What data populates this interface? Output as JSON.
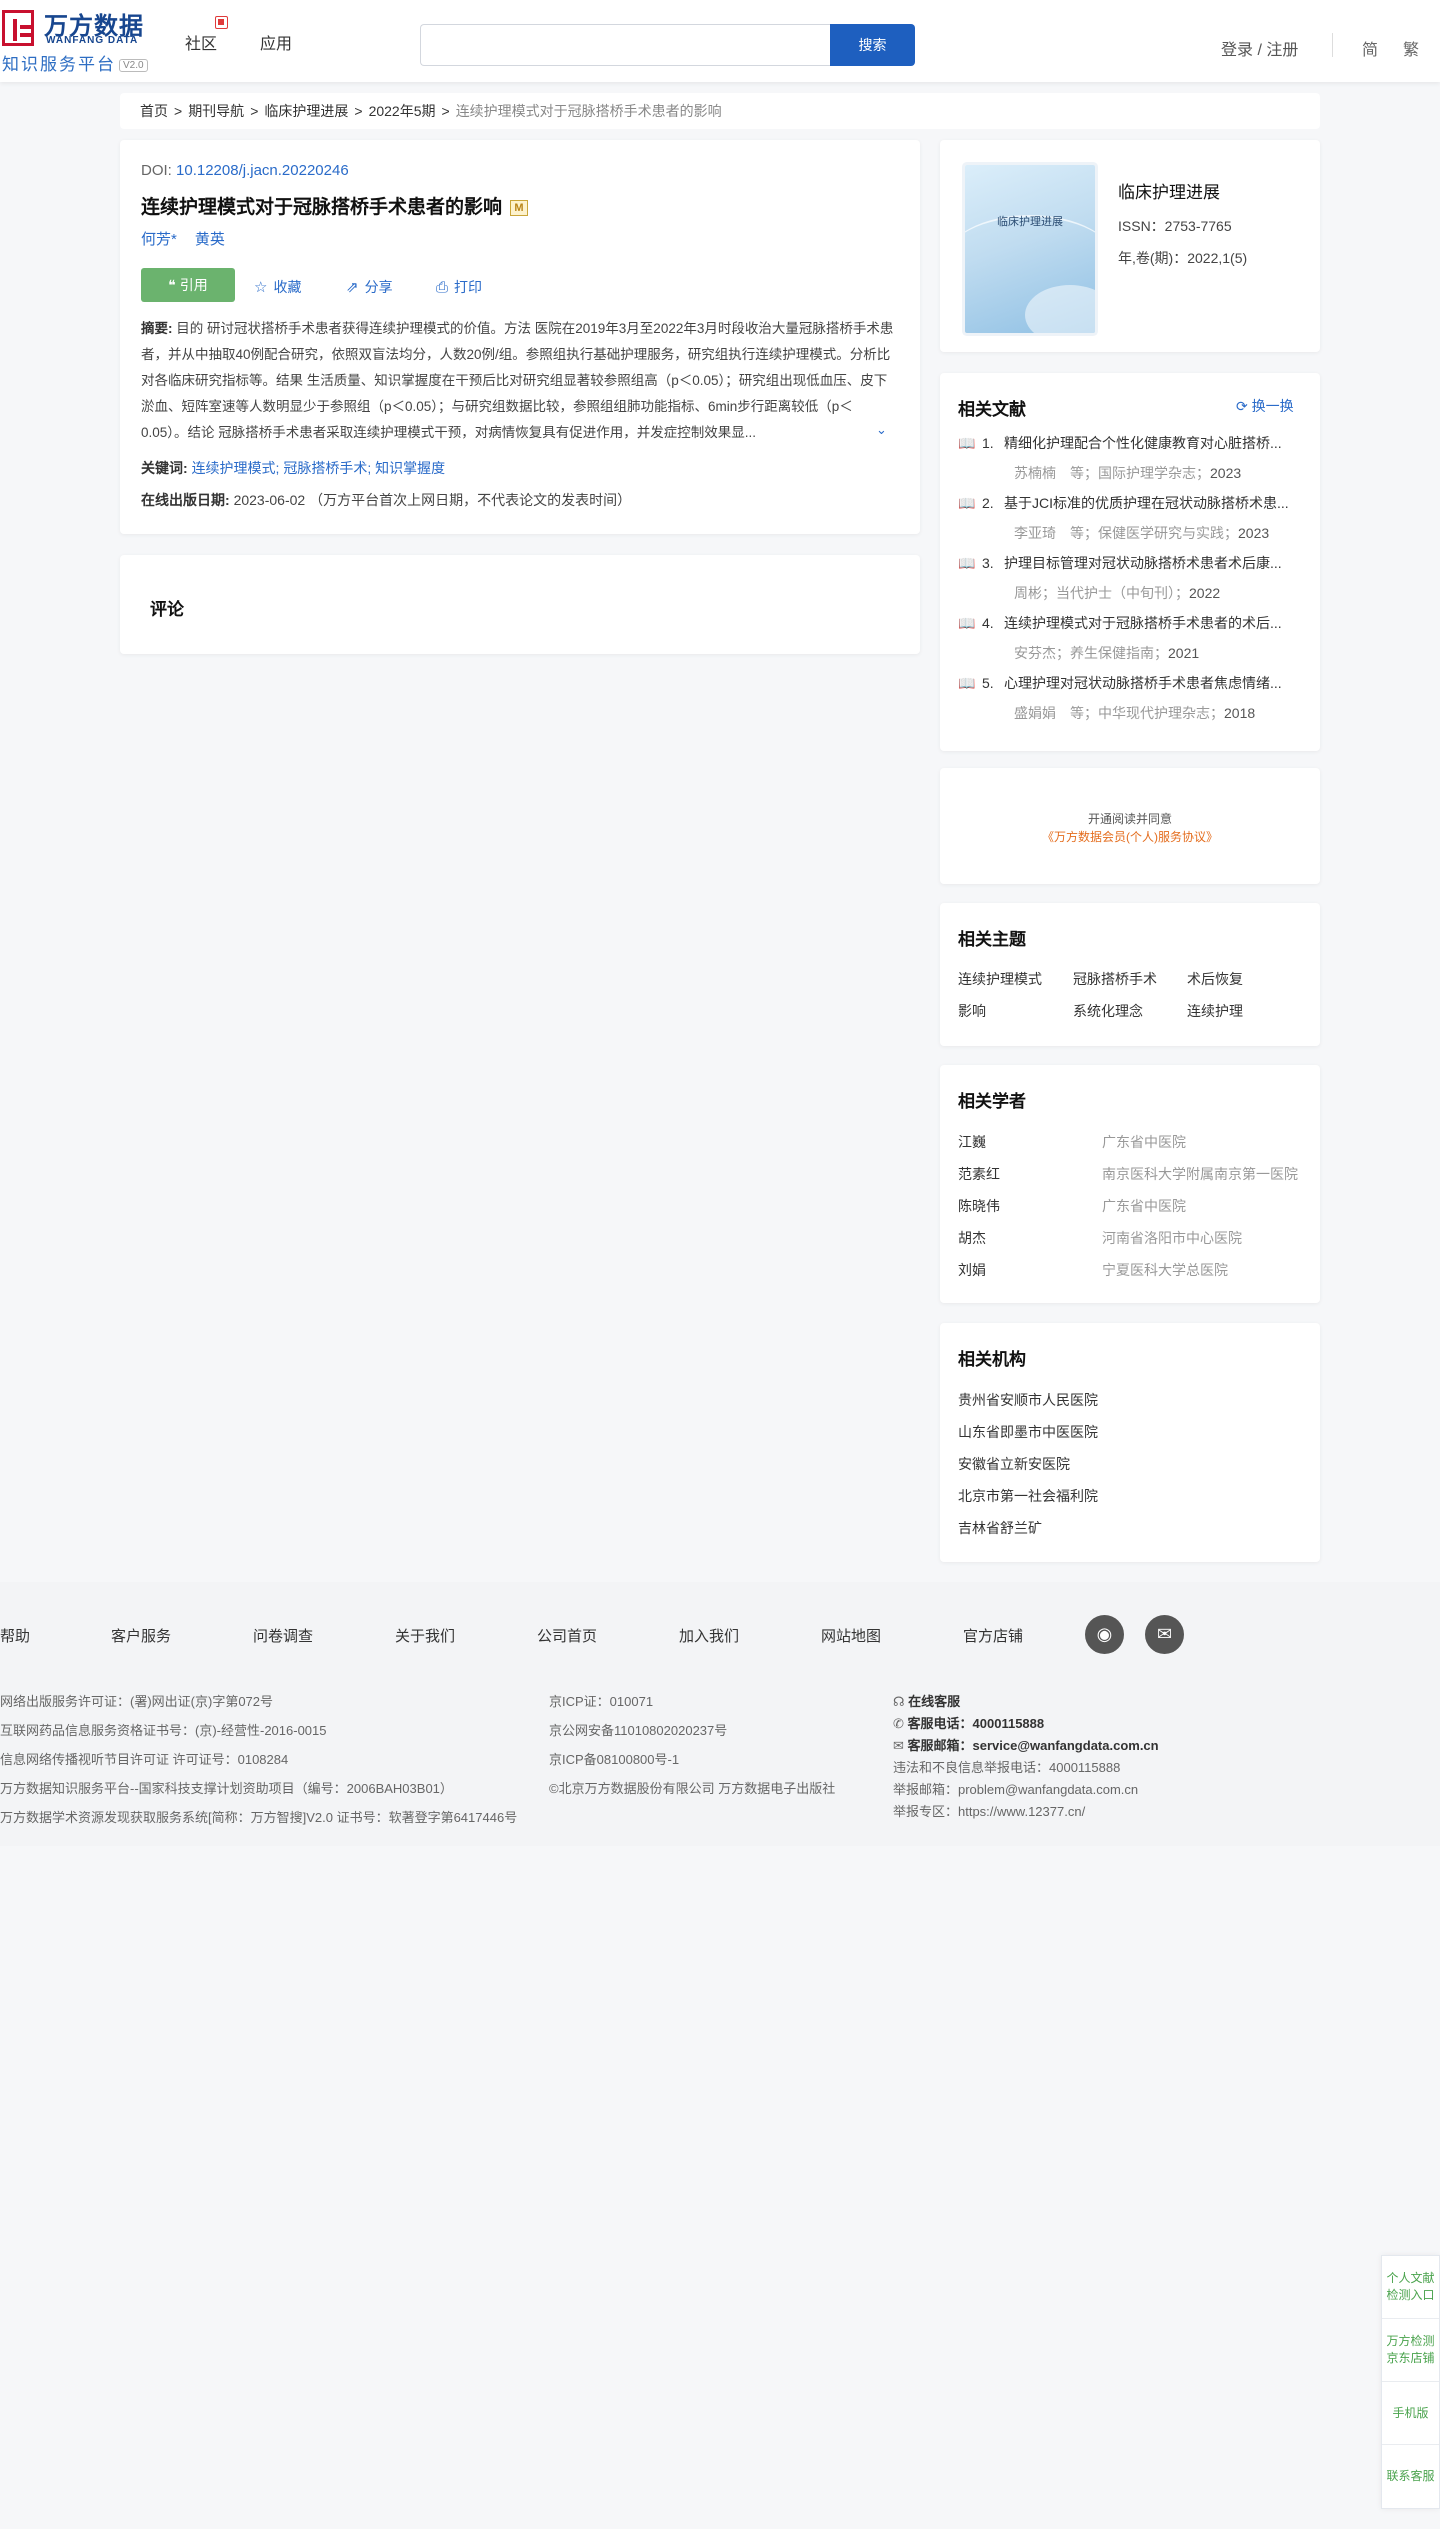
{
  "header": {
    "logo_cn": "万方数据",
    "logo_en": "WANFANG DATA",
    "logo_sub": "知识服务平台",
    "logo_ver": "V2.0",
    "nav": [
      "社区",
      "应用"
    ],
    "search_placeholder": "",
    "search_label": "搜索",
    "login": "登录 / 注册",
    "lang_simplified": "简",
    "lang_traditional": "繁"
  },
  "breadcrumb": {
    "items": [
      "首页",
      "期刊导航",
      "临床护理进展",
      "2022年5期"
    ],
    "current": "连续护理模式对于冠脉搭桥手术患者的影响",
    "sep": ">"
  },
  "article": {
    "doi_label": "DOI:",
    "doi": "10.12208/j.jacn.20220246",
    "title": "连续护理模式对于冠脉搭桥手术患者的影响",
    "title_badge": "M",
    "authors": [
      "何芳*",
      "黄英"
    ],
    "actions": {
      "cite": "引用",
      "favorite": "收藏",
      "share": "分享",
      "print": "打印"
    },
    "abstract_label": "摘要:",
    "abstract": "目的 研讨冠状搭桥手术患者获得连续护理模式的价值。方法 医院在2019年3月至2022年3月时段收治大量冠脉搭桥手术患者，并从中抽取40例配合研究，依照双盲法均分，人数20例/组。参照组执行基础护理服务，研究组执行连续护理模式。分析比对各临床研究指标等。结果 生活质量、知识掌握度在干预后比对研究组显著较参照组高（p＜0.05）；研究组出现低血压、皮下淤血、短阵室速等人数明显少于参照组（p＜0.05）；与研究组数据比较，参照组组肺功能指标、6min步行距离较低（p＜0.05）。结论 冠脉搭桥手术患者采取连续护理模式干预，对病情恢复具有促进作用，并发症控制效果显...",
    "keywords_label": "关键词:",
    "keywords": "连续护理模式; 冠脉搭桥手术; 知识掌握度",
    "pub_label": "在线出版日期:",
    "pub_date": "2023-06-02",
    "pub_note": "（万方平台首次上网日期，不代表论文的发表时间）"
  },
  "comment": {
    "title": "评论"
  },
  "journal": {
    "cover_title": "临床护理进展",
    "name": "临床护理进展",
    "issn": "ISSN：2753-7765",
    "year": "年,卷(期)：2022,1(5)"
  },
  "related_docs": {
    "title": "相关文献",
    "refresh": "换一换",
    "items": [
      {
        "num": "1.",
        "title": "精细化护理配合个性化健康教育对心脏搭桥...",
        "meta": "苏楠楠　等；国际护理学杂志；",
        "year": "2023"
      },
      {
        "num": "2.",
        "title": "基于JCI标准的优质护理在冠状动脉搭桥术患...",
        "meta": "李亚琦　等；保健医学研究与实践；",
        "year": "2023"
      },
      {
        "num": "3.",
        "title": "护理目标管理对冠状动脉搭桥术患者术后康...",
        "meta": "周彬；当代护士（中旬刊）；",
        "year": "2022"
      },
      {
        "num": "4.",
        "title": "连续护理模式对于冠脉搭桥手术患者的术后...",
        "meta": "安芬杰；养生保健指南；",
        "year": "2021"
      },
      {
        "num": "5.",
        "title": "心理护理对冠状动脉搭桥手术患者焦虑情绪...",
        "meta": "盛娟娟　等；中华现代护理杂志；",
        "year": "2018"
      }
    ]
  },
  "subscribe": {
    "line1": "开通阅读并同意",
    "line2": "《万方数据会员(个人)服务协议》"
  },
  "topics": {
    "title": "相关主题",
    "items": [
      "连续护理模式",
      "冠脉搭桥手术",
      "术后恢复",
      "影响",
      "系统化理念",
      "连续护理"
    ]
  },
  "scholars": {
    "title": "相关学者",
    "items": [
      {
        "name": "江巍",
        "org": "广东省中医院"
      },
      {
        "name": "范素红",
        "org": "南京医科大学附属南京第一医院"
      },
      {
        "name": "陈晓伟",
        "org": "广东省中医院"
      },
      {
        "name": "胡杰",
        "org": "河南省洛阳市中心医院"
      },
      {
        "name": "刘娟",
        "org": "宁夏医科大学总医院"
      }
    ]
  },
  "orgs": {
    "title": "相关机构",
    "items": [
      "贵州省安顺市人民医院",
      "山东省即墨市中医医院",
      "安徽省立新安医院",
      "北京市第一社会福利院",
      "吉林省舒兰矿"
    ]
  },
  "footer": {
    "links": [
      "帮助",
      "客户服务",
      "问卷调查",
      "关于我们",
      "公司首页",
      "加入我们",
      "网站地图",
      "官方店铺"
    ],
    "col1": [
      "网络出版服务许可证：(署)网出证(京)字第072号",
      "互联网药品信息服务资格证书号：(京)-经营性-2016-0015",
      "信息网络传播视听节目许可证 许可证号：0108284",
      "万方数据知识服务平台--国家科技支撑计划资助项目（编号：2006BAH03B01）",
      "万方数据学术资源发现获取服务系统[简称：万方智搜]V2.0 证书号：软著登字第6417446号"
    ],
    "col2": [
      "京ICP证：010071",
      "京公网安备11010802020237号",
      "京ICP备08100800号-1",
      "©北京万方数据股份有限公司 万方数据电子出版社"
    ],
    "online_service": "在线客服",
    "phone_label": "客服电话：",
    "phone": "4000115888",
    "email_label": "客服邮箱：",
    "email": "service@wanfangdata.com.cn",
    "report_phone": "违法和不良信息举报电话：4000115888",
    "report_email": "举报邮箱：problem@wanfangdata.com.cn",
    "report_site": "举报专区：https://www.12377.cn/"
  },
  "side_bar": [
    "个人文献检测入口",
    "万方检测京东店铺",
    "手机版",
    "联系客服"
  ]
}
